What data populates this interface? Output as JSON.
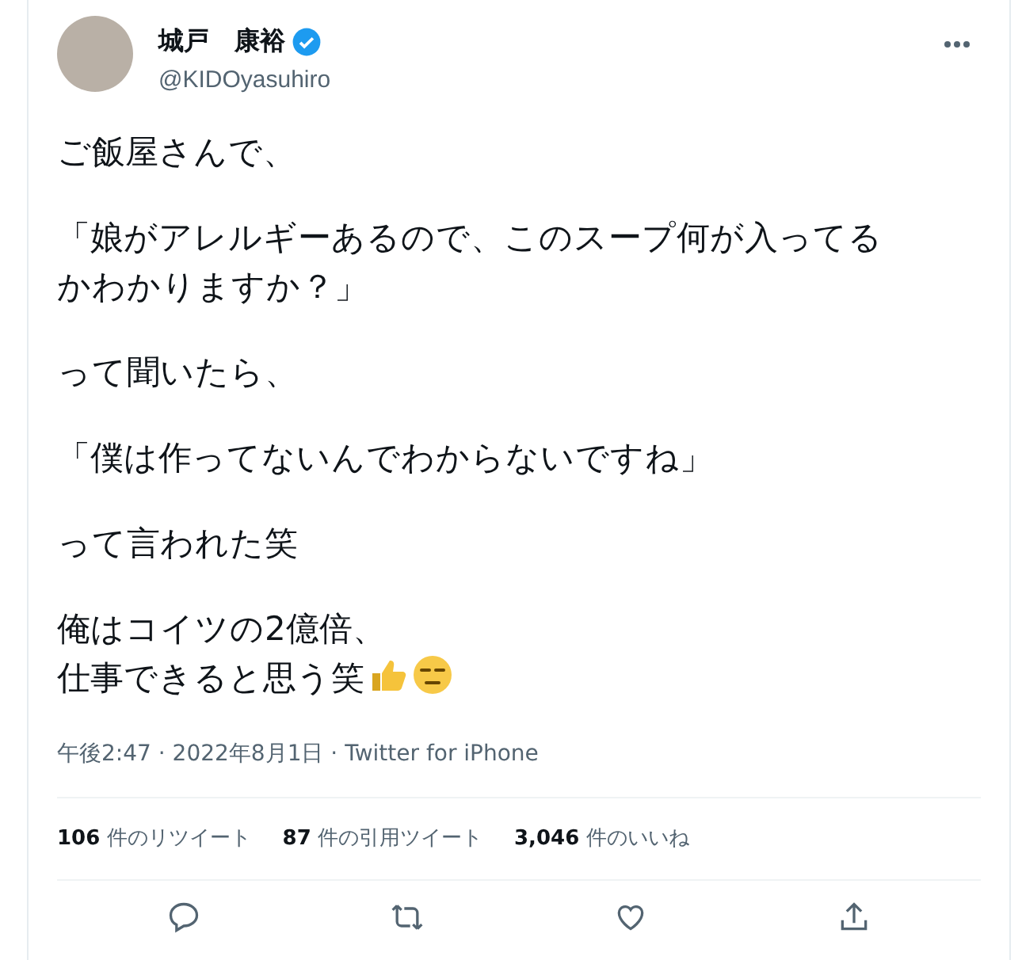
{
  "author": {
    "name": "城戸　康裕",
    "verified": true,
    "handle": "@KIDOyasuhiro"
  },
  "body": [
    {
      "lines": [
        "ご飯屋さんで、"
      ]
    },
    {
      "lines": [
        "「娘がアレルギーあるので、このスープ何が入ってる",
        "かわかりますか？」"
      ]
    },
    {
      "lines": [
        "って聞いたら、"
      ]
    },
    {
      "lines": [
        "「僕は作ってないんでわからないですね」"
      ]
    },
    {
      "lines": [
        "って言われた笑"
      ]
    },
    {
      "lines": [
        "俺はコイツの2億倍、",
        "仕事できると思う笑"
      ],
      "emoji": [
        {
          "kind": "thumbs-up"
        },
        {
          "kind": "expressionless-face"
        }
      ]
    }
  ],
  "meta": "午後2:47 · 2022年8月1日 · Twitter for iPhone",
  "stats": [
    {
      "count": "106",
      "label": "件のリツイート"
    },
    {
      "count": "87",
      "label": "件の引用ツイート"
    },
    {
      "count": "3,046",
      "label": "件のいいね"
    }
  ]
}
